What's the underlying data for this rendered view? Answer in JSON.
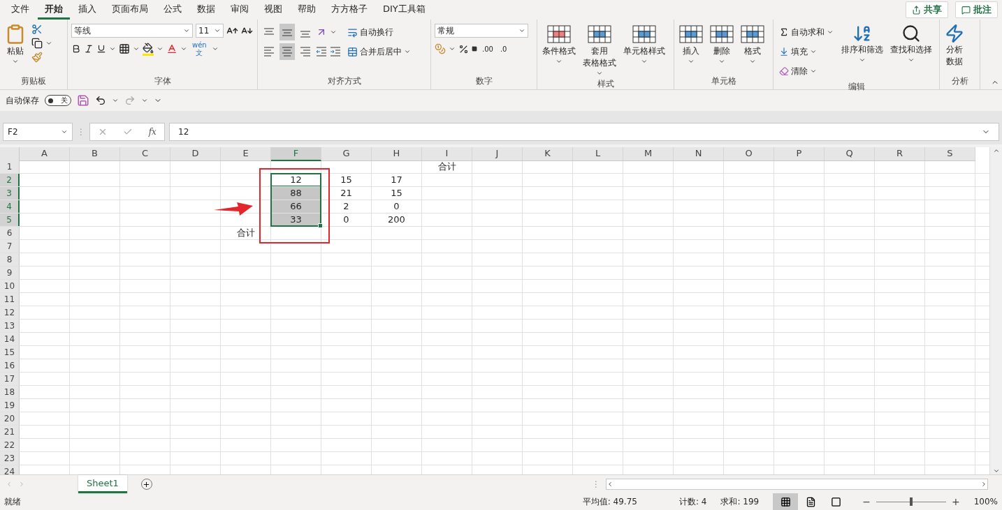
{
  "menu_tabs": [
    {
      "label": "文件",
      "selected": false
    },
    {
      "label": "开始",
      "selected": true
    },
    {
      "label": "插入",
      "selected": false
    },
    {
      "label": "页面布局",
      "selected": false
    },
    {
      "label": "公式",
      "selected": false
    },
    {
      "label": "数据",
      "selected": false
    },
    {
      "label": "审阅",
      "selected": false
    },
    {
      "label": "视图",
      "selected": false
    },
    {
      "label": "帮助",
      "selected": false
    },
    {
      "label": "方方格子",
      "selected": false
    },
    {
      "label": "DIY工具箱",
      "selected": false
    }
  ],
  "share_button": "共享",
  "comment_button": "批注",
  "ribbon": [
    {
      "kind": "clipboard",
      "label": "剪贴板",
      "paste": "粘贴"
    },
    {
      "kind": "font",
      "label": "字体",
      "font_name": "等线",
      "font_size": "11",
      "phonetic_top": "wén",
      "phonetic_bottom": "文"
    },
    {
      "kind": "alignment",
      "label": "对齐方式",
      "valign": [
        {
          "selected": false
        },
        {
          "selected": true
        },
        {
          "selected": false
        }
      ],
      "halign": [
        {
          "selected": false
        },
        {
          "selected": true
        },
        {
          "selected": false
        }
      ],
      "wrap": "自动换行",
      "merge": "合并后居中"
    },
    {
      "kind": "number",
      "label": "数字",
      "format": "常规",
      "decimal_more": ".00",
      "decimal_less": ".0"
    },
    {
      "kind": "styles",
      "label": "样式",
      "buttons": [
        [
          "条件格式"
        ],
        [
          "套用",
          "表格格式"
        ],
        [
          "单元格样式"
        ]
      ]
    },
    {
      "kind": "cells",
      "label": "单元格",
      "buttons": [
        "插入",
        "删除",
        "格式"
      ]
    },
    {
      "kind": "editing",
      "label": "编辑",
      "autosum": "自动求和",
      "fill": "填充",
      "clear": "清除",
      "sort": "排序和筛选",
      "find": "查找和选择"
    },
    {
      "kind": "analysis",
      "label": "分析",
      "lines": [
        "分析",
        "数据"
      ]
    }
  ],
  "quick_access": {
    "autosave_label": "自动保存",
    "autosave": {
      "on": false,
      "label": "关"
    }
  },
  "formula_bar": {
    "name_box": "F2",
    "separator": "⋮",
    "fx_label": "fx",
    "value": "12"
  },
  "columns": [
    {
      "label": "A",
      "selected": false
    },
    {
      "label": "B",
      "selected": false
    },
    {
      "label": "C",
      "selected": false
    },
    {
      "label": "D",
      "selected": false
    },
    {
      "label": "E",
      "selected": false
    },
    {
      "label": "F",
      "selected": true
    },
    {
      "label": "G",
      "selected": false
    },
    {
      "label": "H",
      "selected": false
    },
    {
      "label": "I",
      "selected": false
    },
    {
      "label": "J",
      "selected": false
    },
    {
      "label": "K",
      "selected": false
    },
    {
      "label": "L",
      "selected": false
    },
    {
      "label": "M",
      "selected": false
    },
    {
      "label": "N",
      "selected": false
    },
    {
      "label": "O",
      "selected": false
    },
    {
      "label": "P",
      "selected": false
    },
    {
      "label": "Q",
      "selected": false
    },
    {
      "label": "R",
      "selected": false
    },
    {
      "label": "S",
      "selected": false
    }
  ],
  "rows": [
    {
      "label": "1",
      "selected": false,
      "cells": [
        {
          "selected": false,
          "active": false
        },
        {
          "selected": false,
          "active": false
        },
        {
          "selected": false,
          "active": false
        },
        {
          "selected": false,
          "active": false
        },
        {
          "selected": false,
          "active": false
        },
        {
          "selected": false,
          "active": false
        },
        {
          "selected": false,
          "active": false
        },
        {
          "selected": false,
          "active": false
        },
        {
          "text": "合计",
          "selected": false,
          "active": false
        }
      ]
    },
    {
      "label": "2",
      "selected": true,
      "cells": [
        {
          "selected": false,
          "active": false
        },
        {
          "selected": false,
          "active": false
        },
        {
          "selected": false,
          "active": false
        },
        {
          "selected": false,
          "active": false
        },
        {
          "selected": false,
          "active": false
        },
        {
          "text": "12",
          "selected": true,
          "active": true
        },
        {
          "text": "15",
          "selected": false,
          "active": false
        },
        {
          "text": "17",
          "selected": false,
          "active": false
        }
      ]
    },
    {
      "label": "3",
      "selected": true,
      "cells": [
        {
          "selected": false,
          "active": false
        },
        {
          "selected": false,
          "active": false
        },
        {
          "selected": false,
          "active": false
        },
        {
          "selected": false,
          "active": false
        },
        {
          "selected": false,
          "active": false
        },
        {
          "text": "88",
          "selected": true,
          "active": false
        },
        {
          "text": "21",
          "selected": false,
          "active": false
        },
        {
          "text": "15",
          "selected": false,
          "active": false
        }
      ]
    },
    {
      "label": "4",
      "selected": true,
      "cells": [
        {
          "selected": false,
          "active": false
        },
        {
          "selected": false,
          "active": false
        },
        {
          "selected": false,
          "active": false
        },
        {
          "selected": false,
          "active": false
        },
        {
          "selected": false,
          "active": false
        },
        {
          "text": "66",
          "selected": true,
          "active": false
        },
        {
          "text": "2",
          "selected": false,
          "active": false
        },
        {
          "text": "0",
          "selected": false,
          "active": false
        }
      ]
    },
    {
      "label": "5",
      "selected": true,
      "cells": [
        {
          "selected": false,
          "active": false
        },
        {
          "selected": false,
          "active": false
        },
        {
          "selected": false,
          "active": false
        },
        {
          "selected": false,
          "active": false
        },
        {
          "selected": false,
          "active": false
        },
        {
          "text": "33",
          "selected": true,
          "active": false
        },
        {
          "text": "0",
          "selected": false,
          "active": false
        },
        {
          "text": "200",
          "selected": false,
          "active": false
        }
      ]
    },
    {
      "label": "6",
      "selected": false,
      "cells": [
        {
          "selected": false,
          "active": false
        },
        {
          "selected": false,
          "active": false
        },
        {
          "selected": false,
          "active": false
        },
        {
          "selected": false,
          "active": false
        },
        {
          "text": "合计",
          "selected": false,
          "active": false
        }
      ]
    },
    {
      "label": "7",
      "selected": false,
      "cells": []
    },
    {
      "label": "8",
      "selected": false,
      "cells": []
    },
    {
      "label": "9",
      "selected": false,
      "cells": []
    },
    {
      "label": "10",
      "selected": false,
      "cells": []
    },
    {
      "label": "11",
      "selected": false,
      "cells": []
    },
    {
      "label": "12",
      "selected": false,
      "cells": []
    },
    {
      "label": "13",
      "selected": false,
      "cells": []
    },
    {
      "label": "14",
      "selected": false,
      "cells": []
    },
    {
      "label": "15",
      "selected": false,
      "cells": []
    },
    {
      "label": "16",
      "selected": false,
      "cells": []
    },
    {
      "label": "17",
      "selected": false,
      "cells": []
    },
    {
      "label": "18",
      "selected": false,
      "cells": []
    },
    {
      "label": "19",
      "selected": false,
      "cells": []
    },
    {
      "label": "20",
      "selected": false,
      "cells": []
    },
    {
      "label": "21",
      "selected": false,
      "cells": []
    },
    {
      "label": "22",
      "selected": false,
      "cells": []
    },
    {
      "label": "23",
      "selected": false,
      "cells": []
    },
    {
      "label": "24",
      "selected": false,
      "cells": []
    }
  ],
  "sheet_tabs": [
    {
      "label": "Sheet1",
      "selected": true
    }
  ],
  "tab_split": "⋮",
  "status_bar": {
    "mode": "就绪",
    "average": "平均值: 49.75",
    "count": "计数: 4",
    "sum": "求和: 199",
    "views": [
      {
        "kind": "normal",
        "selected": true
      },
      {
        "kind": "page-layout",
        "selected": false
      },
      {
        "kind": "page-break",
        "selected": false
      }
    ],
    "zoom_out": "−",
    "zoom_in": "+",
    "zoom": {
      "level": 0.5
    },
    "zoom_label": "100%"
  }
}
